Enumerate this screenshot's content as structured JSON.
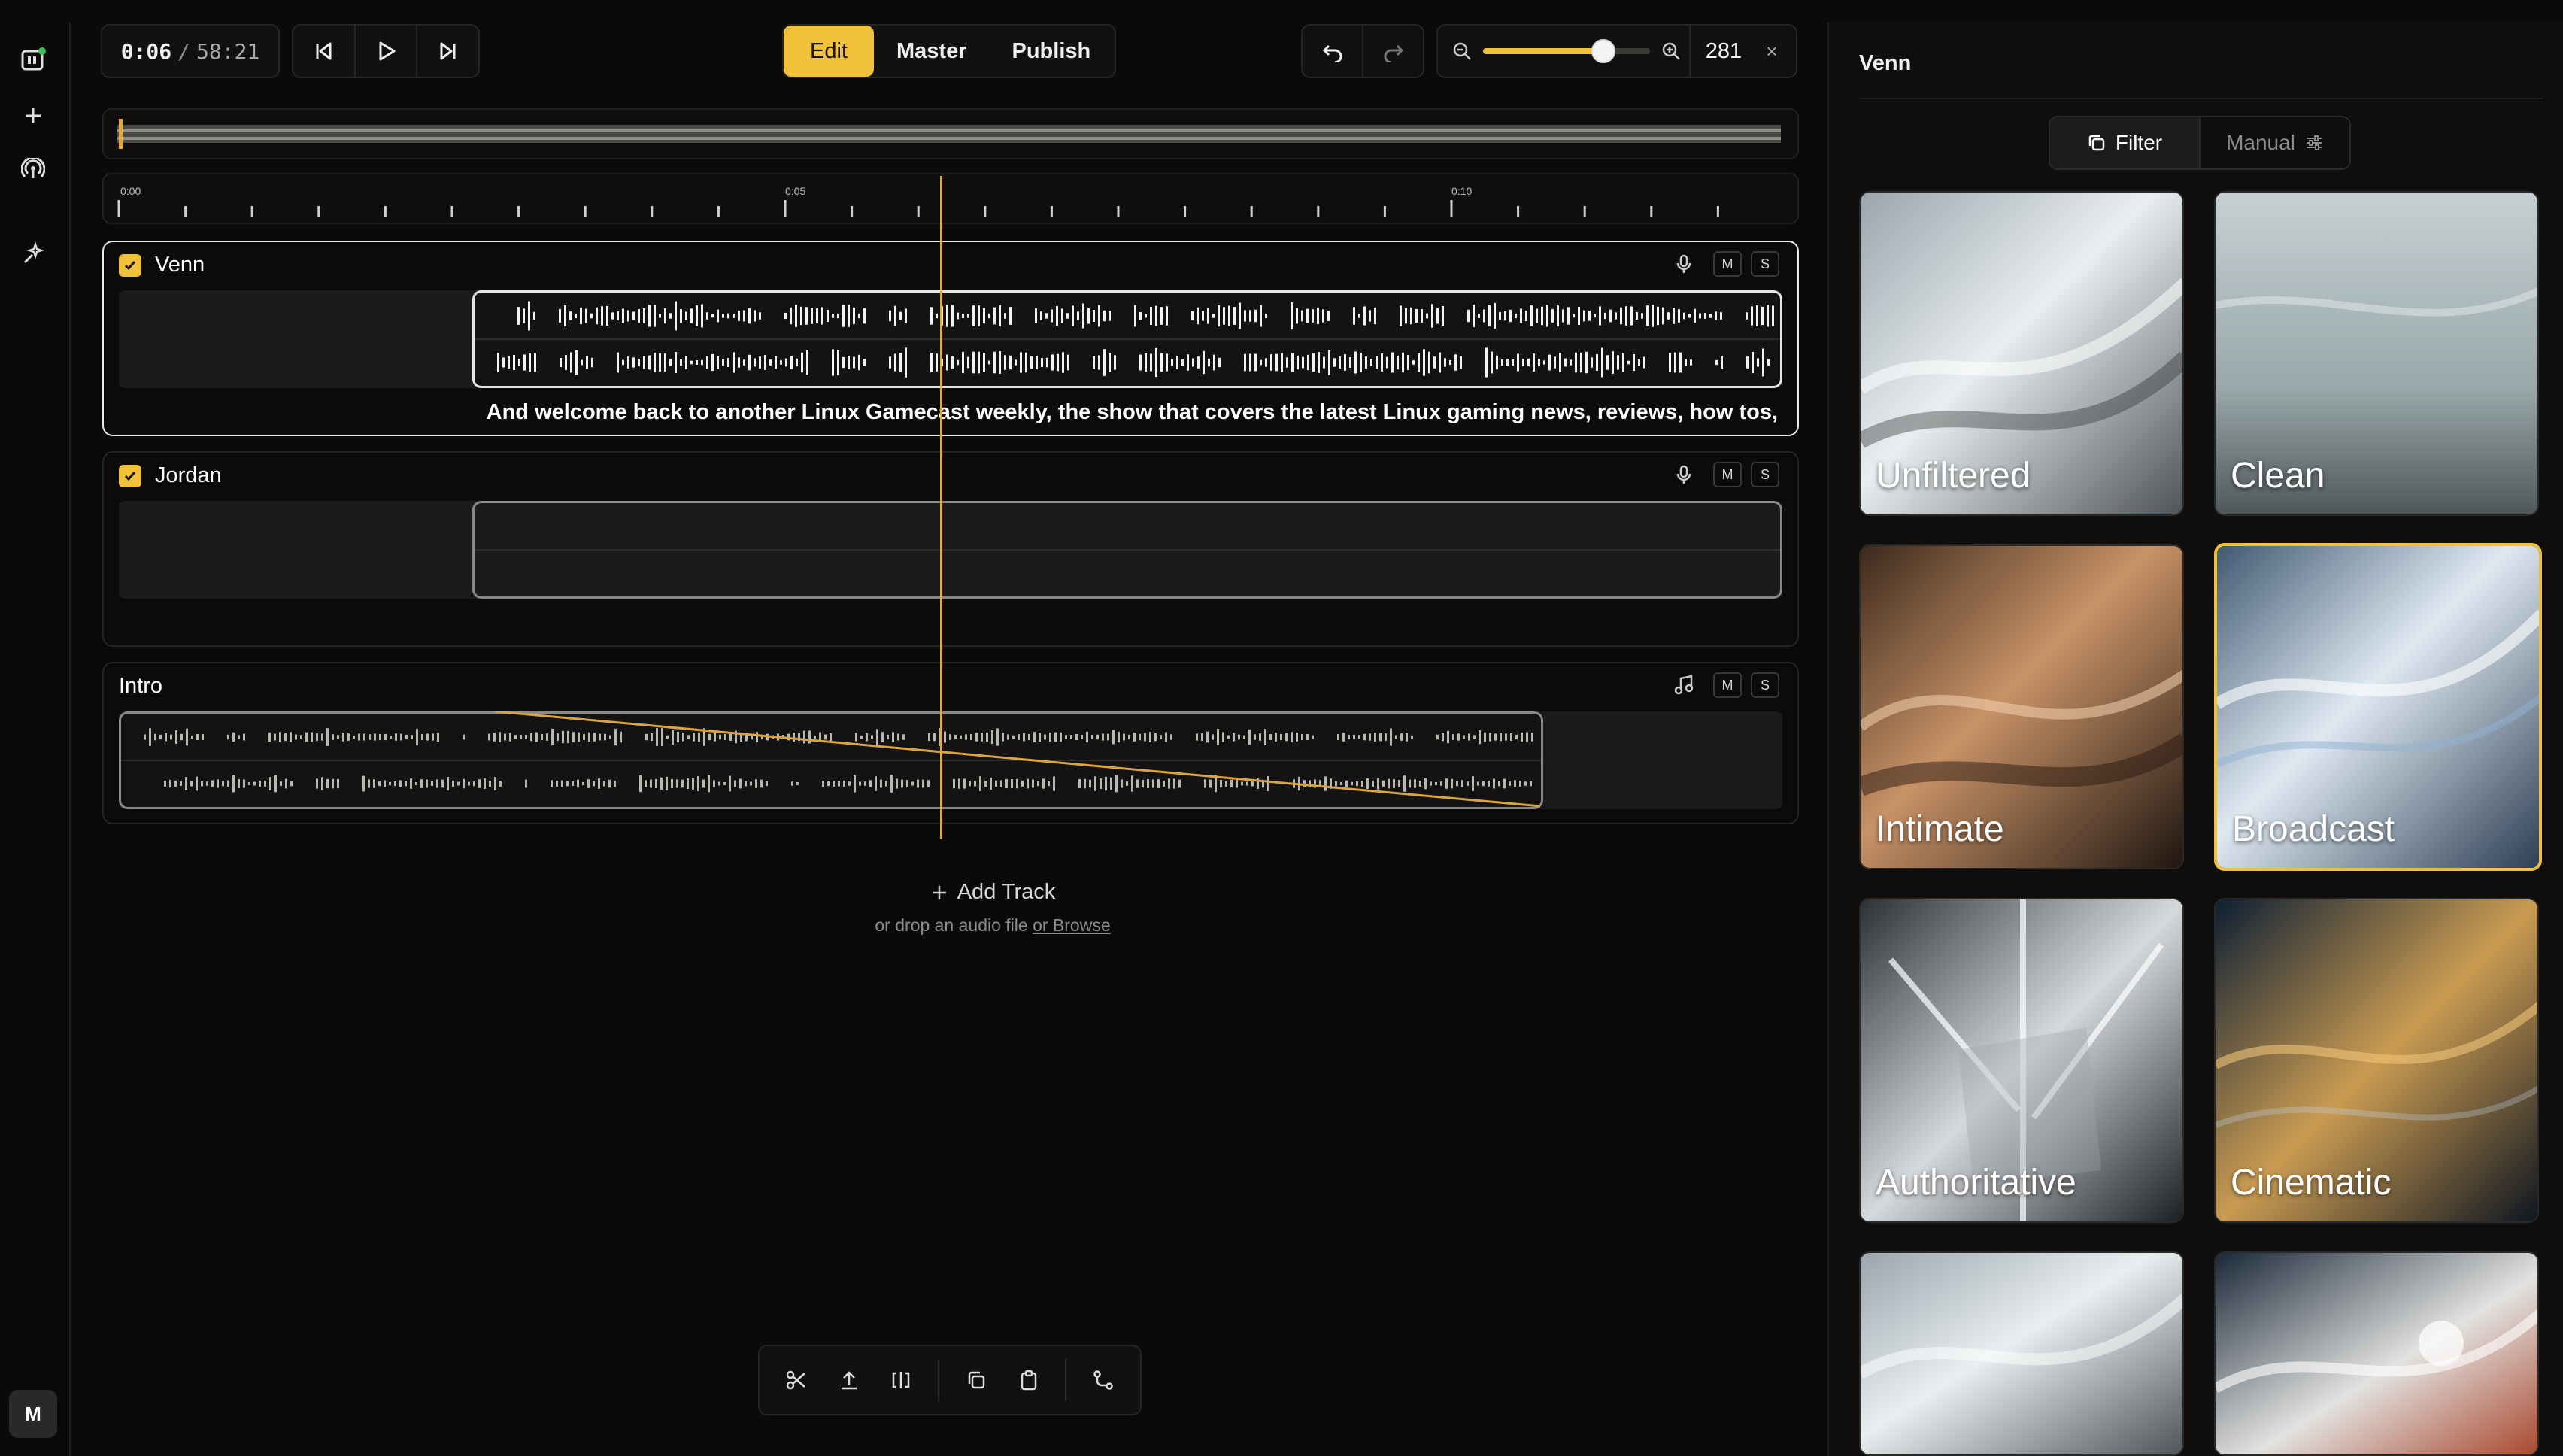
{
  "transport": {
    "current_time": "0:06",
    "separator": "/",
    "total_time": "58:21"
  },
  "modes": [
    {
      "label": "Edit",
      "active": true
    },
    {
      "label": "Master",
      "active": false
    },
    {
      "label": "Publish",
      "active": false
    }
  ],
  "zoom": {
    "value": "281",
    "close": "×",
    "level_fraction": 0.72
  },
  "ruler": {
    "labels": [
      "0:00",
      "0:05",
      "0:10"
    ]
  },
  "tracks": [
    {
      "name": "Venn",
      "checked": true,
      "icon": "mic-icon",
      "mute": "M",
      "solo": "S",
      "subtitle": "And welcome back to another Linux Gamecast weekly, the show that covers the latest Linux gaming news, reviews, how tos,"
    },
    {
      "name": "Jordan",
      "checked": true,
      "icon": "mic-icon",
      "mute": "M",
      "solo": "S"
    },
    {
      "name": "Intro",
      "checked": false,
      "icon": "music-note-icon",
      "mute": "M",
      "solo": "S"
    }
  ],
  "add_track": {
    "label": "Add Track",
    "hint_prefix": "or drop an audio file ",
    "hint_link": "or Browse"
  },
  "sidebar": {
    "avatar": "M",
    "icons": [
      "podcast-logo-icon",
      "plus-icon",
      "broadcast-icon",
      "sparkle-icon"
    ]
  },
  "toolbar": {
    "icons": [
      "scissors-icon",
      "upload-icon",
      "split-icon",
      "copy-icon",
      "paste-icon",
      "route-icon"
    ]
  },
  "panel": {
    "title": "Venn",
    "filter_label": "Filter",
    "manual_label": "Manual",
    "presets": [
      {
        "label": "Unfiltered",
        "selected": false
      },
      {
        "label": "Clean",
        "selected": false
      },
      {
        "label": "Intimate",
        "selected": false
      },
      {
        "label": "Broadcast",
        "selected": true
      },
      {
        "label": "Authoritative",
        "selected": false
      },
      {
        "label": "Cinematic",
        "selected": false
      },
      {
        "label": "",
        "selected": false
      },
      {
        "label": "",
        "selected": false
      }
    ]
  },
  "colors": {
    "accent": "#f2c13c",
    "background": "#0b0a09",
    "playhead": "#e5a83a"
  }
}
